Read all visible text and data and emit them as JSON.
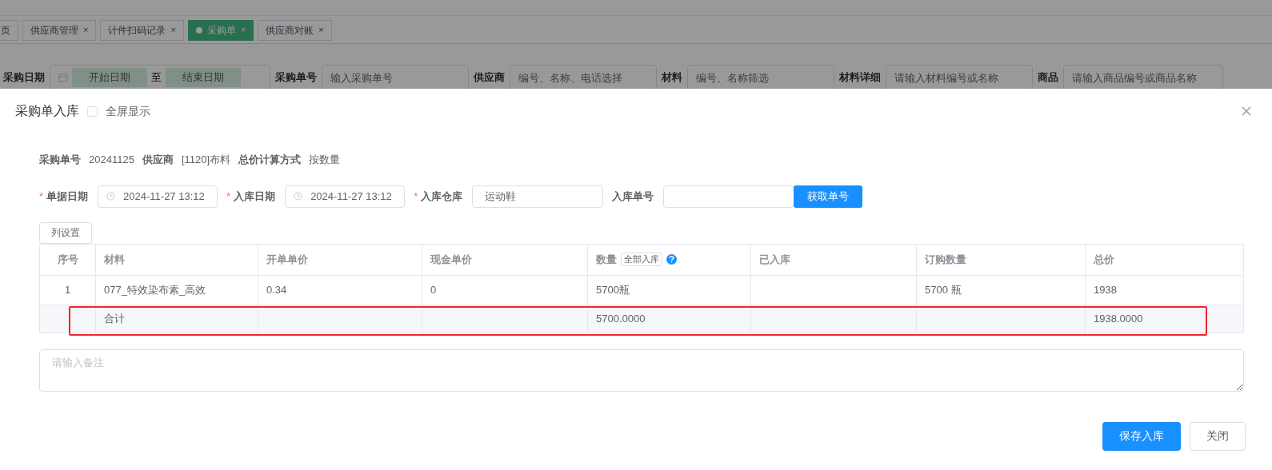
{
  "background_page": {
    "tabs": [
      {
        "label": "页",
        "selected": false
      },
      {
        "label": "供应商管理",
        "selected": false,
        "close": "×"
      },
      {
        "label": "计件扫码记录",
        "selected": false,
        "close": "×"
      },
      {
        "label": "采购单",
        "selected": true,
        "close": "×"
      },
      {
        "label": "供应商对账",
        "selected": false,
        "close": "×"
      }
    ],
    "filters": [
      {
        "label": "采购日期",
        "kind": "daterange",
        "start_placeholder": "开始日期",
        "separator": "至",
        "end_placeholder": "结束日期"
      },
      {
        "label": "采购单号",
        "kind": "text",
        "placeholder": "输入采购单号"
      },
      {
        "label": "供应商",
        "kind": "text",
        "placeholder": "编号、名称、电话选择"
      },
      {
        "label": "材料",
        "kind": "text",
        "placeholder": "编号、名称筛选"
      },
      {
        "label": "材料详细",
        "kind": "text",
        "placeholder": "请输入材料编号或名称"
      },
      {
        "label": "商品",
        "kind": "text",
        "placeholder": "请输入商品编号或商品名称"
      }
    ]
  },
  "dialog": {
    "title": "采购单入库",
    "fullscreen": {
      "label": "全屏显示",
      "checked": false
    },
    "info": [
      {
        "label": "采购单号",
        "value": "20241125"
      },
      {
        "label": "供应商",
        "value": "[1120]布料"
      },
      {
        "label": "总价计算方式",
        "value": "按数量"
      }
    ],
    "form": [
      {
        "label": "单据日期",
        "required_mark": "*",
        "kind": "date",
        "value": "2024-11-27 13:12"
      },
      {
        "label": "入库日期",
        "required_mark": "*",
        "kind": "date",
        "value": "2024-11-27 13:12"
      },
      {
        "label": "入库仓库",
        "required_mark": "*",
        "kind": "text",
        "value": "运动鞋"
      },
      {
        "label": "入库单号",
        "kind": "text",
        "button": "获取单号"
      }
    ],
    "column_settings_button": "列设置",
    "table": {
      "columns": [
        {
          "label": "序号"
        },
        {
          "label": "材料"
        },
        {
          "label": "开单单价"
        },
        {
          "label": "现金单价"
        },
        {
          "label": "数量",
          "button": "全部入库",
          "help": true
        },
        {
          "label": "已入库"
        },
        {
          "label": "订购数量"
        },
        {
          "label": "总价"
        }
      ],
      "rows": [
        {
          "cells": [
            "1",
            "077_特效染布素_高效",
            "0.34",
            "0",
            "5700瓶",
            "",
            "5700 瓶",
            "1938"
          ]
        }
      ],
      "summary": {
        "cells": [
          "",
          "合计",
          "",
          "",
          "5700.0000",
          "",
          "",
          "1938.0000"
        ],
        "highlighted": true
      }
    },
    "remarks": {
      "placeholder": "请输入备注"
    },
    "buttons": [
      {
        "label": "保存入库",
        "kind": "primary"
      },
      {
        "label": "关闭",
        "kind": "default"
      }
    ]
  }
}
